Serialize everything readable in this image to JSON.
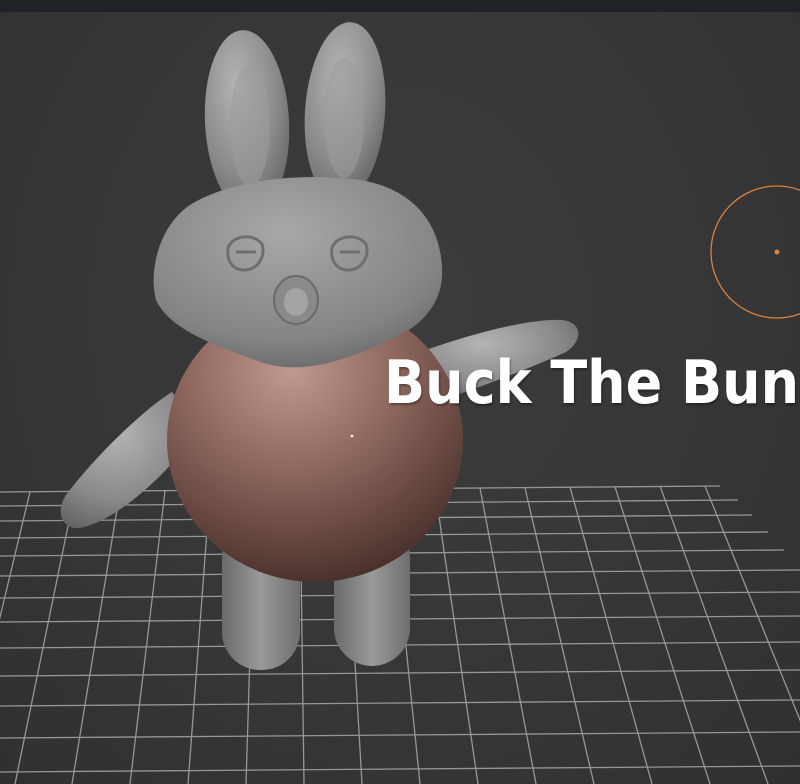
{
  "viewport": {
    "title_text": "Buck The Bunny",
    "background_color": "#3a3a3a",
    "grid_color": "#a8a8a8",
    "body_color": "#7a5a52",
    "model_color": "#8a8a8a",
    "cursor_color": "#d9823b"
  },
  "icons": {
    "cursor": "3d-cursor-icon",
    "origin": "object-origin-icon"
  }
}
